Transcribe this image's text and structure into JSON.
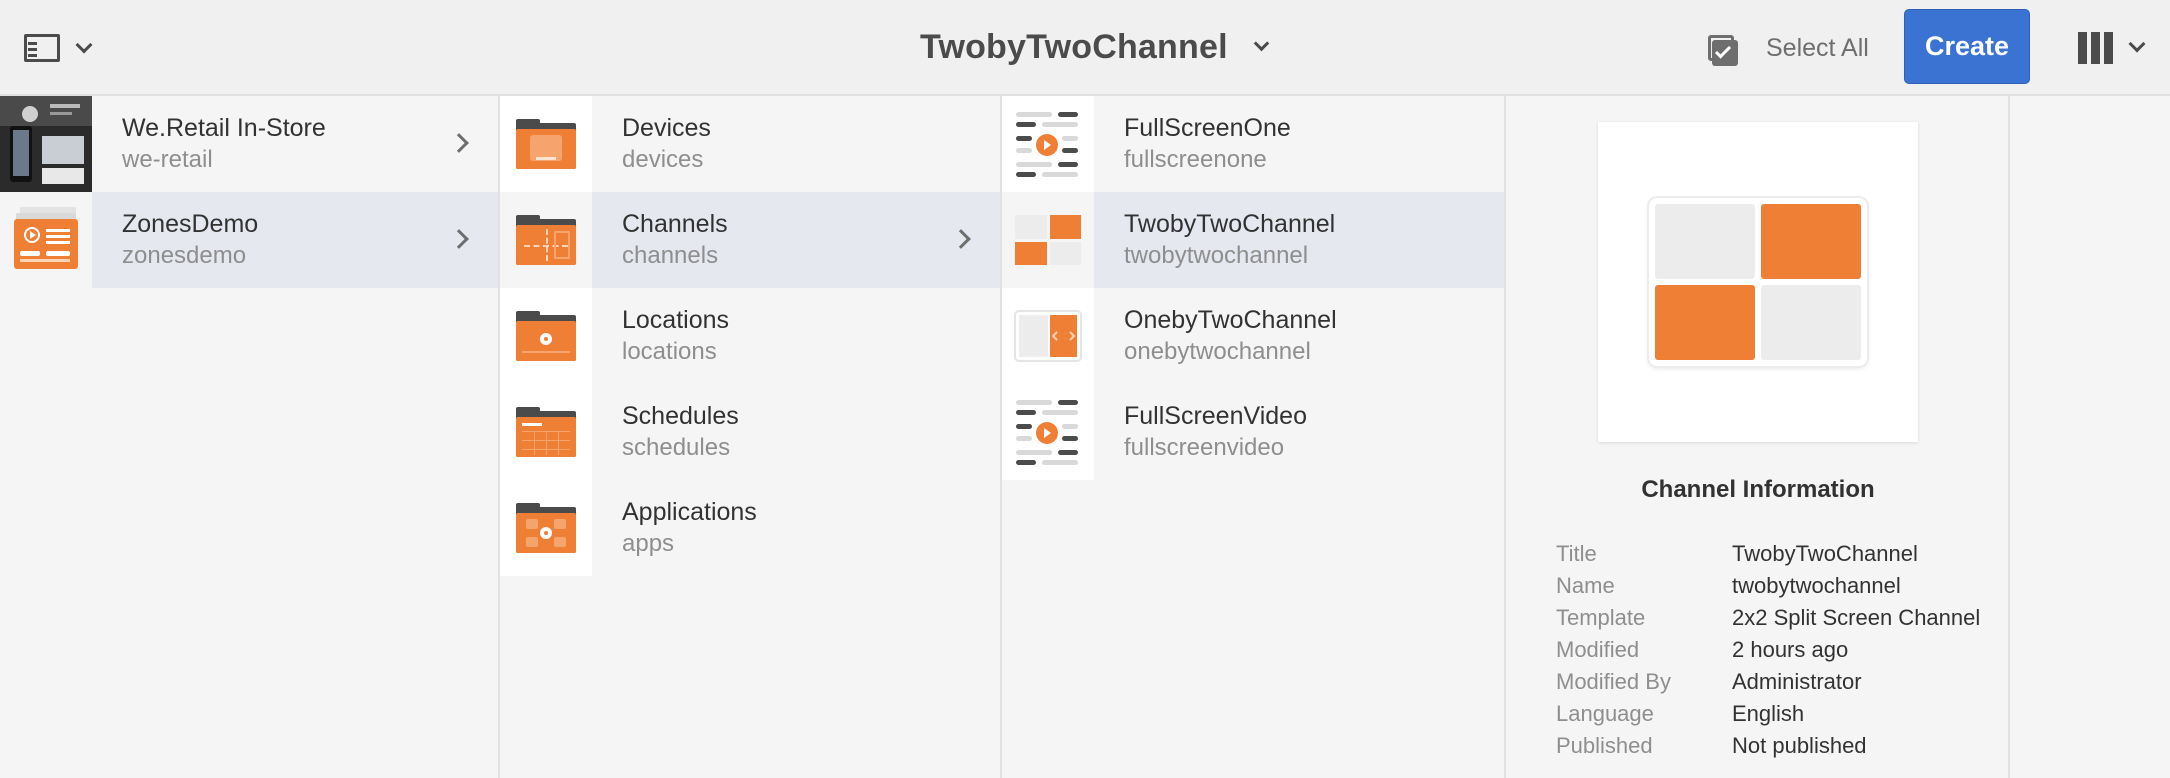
{
  "header": {
    "title": "TwobyTwoChannel",
    "select_all_label": "Select All",
    "create_label": "Create",
    "rail_toggle_icon": "panel-toggle-icon",
    "view_icon": "column-view-icon"
  },
  "colors": {
    "accent_orange": "#ef7f35",
    "primary_button": "#3b73d3",
    "selected_row": "#e5e8ef"
  },
  "columns": [
    {
      "items": [
        {
          "title": "We.Retail In-Store",
          "name": "we-retail",
          "selected": false,
          "has_children": true
        },
        {
          "title": "ZonesDemo",
          "name": "zonesdemo",
          "selected": true,
          "has_children": true
        }
      ]
    },
    {
      "items": [
        {
          "title": "Devices",
          "name": "devices",
          "selected": false,
          "has_children": false
        },
        {
          "title": "Channels",
          "name": "channels",
          "selected": true,
          "has_children": true
        },
        {
          "title": "Locations",
          "name": "locations",
          "selected": false,
          "has_children": false
        },
        {
          "title": "Schedules",
          "name": "schedules",
          "selected": false,
          "has_children": false
        },
        {
          "title": "Applications",
          "name": "apps",
          "selected": false,
          "has_children": false
        }
      ]
    },
    {
      "items": [
        {
          "title": "FullScreenOne",
          "name": "fullscreenone",
          "selected": false
        },
        {
          "title": "TwobyTwoChannel",
          "name": "twobytwochannel",
          "selected": true
        },
        {
          "title": "OnebyTwoChannel",
          "name": "onebytwochannel",
          "selected": false
        },
        {
          "title": "FullScreenVideo",
          "name": "fullscreenvideo",
          "selected": false
        }
      ]
    }
  ],
  "info": {
    "heading": "Channel Information",
    "properties": [
      {
        "label": "Title",
        "value": "TwobyTwoChannel"
      },
      {
        "label": "Name",
        "value": "twobytwochannel"
      },
      {
        "label": "Template",
        "value": "2x2 Split Screen Channel"
      },
      {
        "label": "Modified",
        "value": "2 hours ago"
      },
      {
        "label": "Modified By",
        "value": "Administrator"
      },
      {
        "label": "Language",
        "value": "English"
      },
      {
        "label": "Published",
        "value": "Not published"
      }
    ]
  }
}
